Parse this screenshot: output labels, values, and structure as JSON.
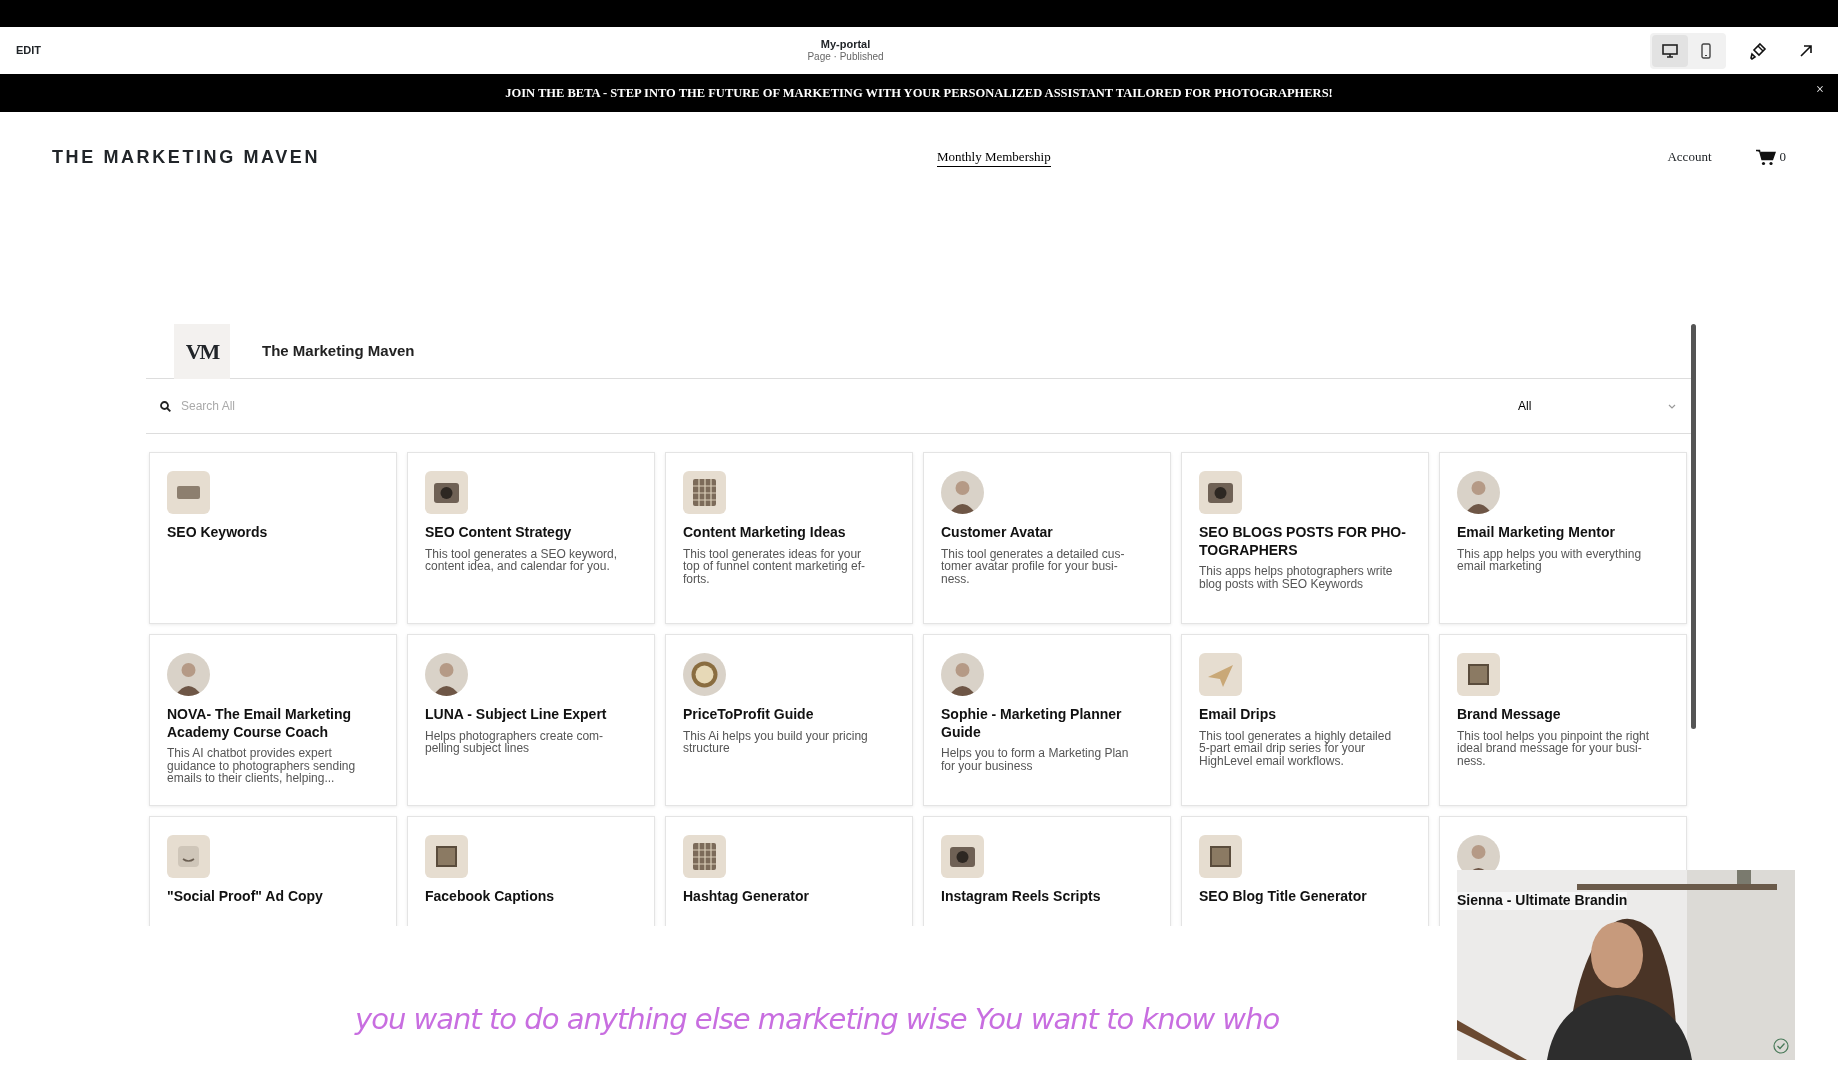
{
  "editor_bar": {
    "edit_label": "EDIT",
    "page_title": "My-portal",
    "page_status": "Page · Published",
    "devices": [
      {
        "kind": "desktop",
        "selected": true
      },
      {
        "kind": "mobile",
        "selected": false
      }
    ]
  },
  "banner": {
    "text": "JOIN THE BETA - STEP INTO THE FUTURE OF MARKETING WITH YOUR PERSONALIZED ASSISTANT TAILORED FOR PHOTOGRAPHERS!",
    "close": "×"
  },
  "site_header": {
    "brand": "THE MARKETING MAVEN",
    "nav": [
      {
        "label": "Monthly Membership",
        "selected": true
      }
    ],
    "account": "Account",
    "cart_count": "0"
  },
  "portal": {
    "logo": "VM",
    "title": "The Marketing Maven",
    "search": {
      "placeholder": "Search All"
    },
    "filter": "All",
    "cards": [
      {
        "kind": "text",
        "title": "SEO Keywords"
      },
      {
        "kind": "camera",
        "title": "SEO Content Strategy",
        "description": "This tool generates a SEO keyword, content idea, and calendar for you."
      },
      {
        "kind": "grid",
        "title": "Content Marketing Ideas",
        "description": "This tool generates ideas for your top of funnel content marketing ef-forts."
      },
      {
        "kind": "person",
        "title": "Customer Avatar",
        "description": "This tool generates a detailed cus-tomer avatar profile for your busi-ness."
      },
      {
        "kind": "camera",
        "title": "SEO BLOGS POSTS FOR PHO-TOGRAPHERS",
        "description": "This apps helps photographers write blog posts with SEO Keywords"
      },
      {
        "kind": "person",
        "title": "Email Marketing Mentor",
        "description": "This app helps you with everything email marketing"
      },
      {
        "kind": "person",
        "title": "NOVA- The Email Marketing Academy Course Coach",
        "description": "This AI chatbot provides expert guidance to photographers sending emails to their clients, helping..."
      },
      {
        "kind": "person",
        "title": "LUNA - Subject Line Expert",
        "description": "Helps photographers create com-pelling subject lines"
      },
      {
        "kind": "coin",
        "title": "PriceToProfit Guide",
        "description": "This Ai helps you build your pricing structure"
      },
      {
        "kind": "person",
        "title": "Sophie - Marketing Planner Guide",
        "description": "Helps you to form a Marketing Plan for your business"
      },
      {
        "kind": "plane",
        "title": "Email Drips",
        "description": "This tool generates a highly detailed 5-part email drip series for your HighLevel email workflows."
      },
      {
        "kind": "square",
        "title": "Brand Message",
        "description": "This tool helps you pinpoint the right ideal brand message for your busi-ness."
      },
      {
        "kind": "smile",
        "title": "\"Social Proof\" Ad Copy"
      },
      {
        "kind": "square",
        "title": "Facebook Captions"
      },
      {
        "kind": "grid",
        "title": "Hashtag Generator"
      },
      {
        "kind": "camera",
        "title": "Instagram Reels Scripts"
      },
      {
        "kind": "square",
        "title": "SEO Blog Title Generator"
      },
      {
        "kind": "person",
        "title": "Sienna - Ultimate Brandin"
      }
    ]
  },
  "caption": "you want to do anything else marketing wise You want to know who"
}
